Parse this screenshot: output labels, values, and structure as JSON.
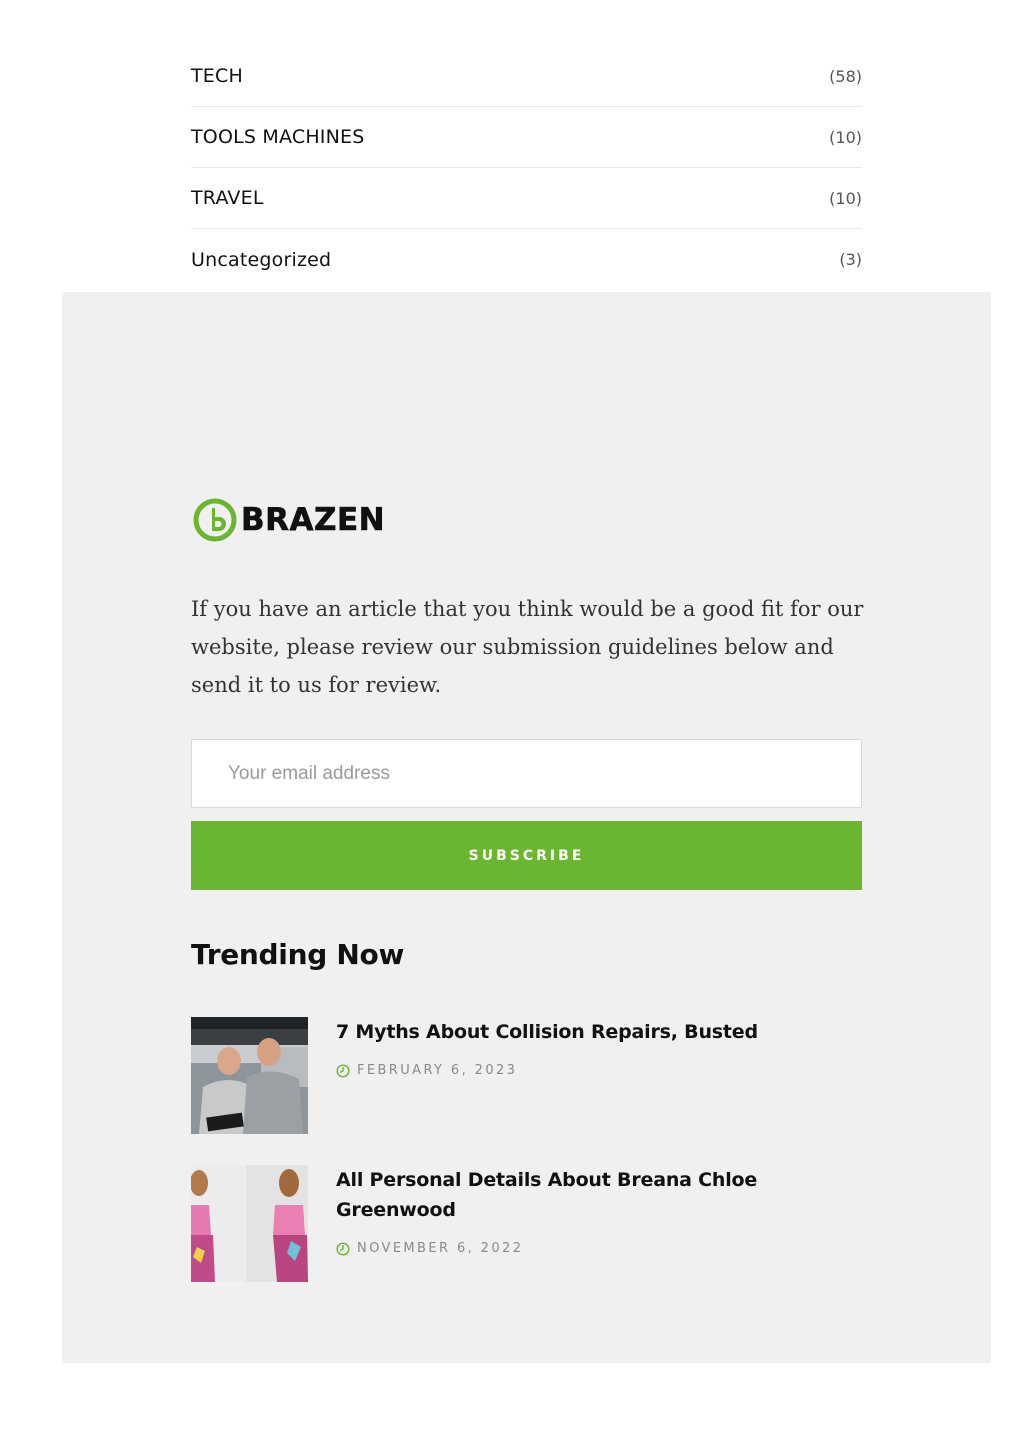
{
  "categories": [
    {
      "name": "TECH",
      "count": "(58)"
    },
    {
      "name": "TOOLS MACHINES",
      "count": "(10)"
    },
    {
      "name": "TRAVEL",
      "count": "(10)"
    },
    {
      "name": "Uncategorized",
      "count": "(3)"
    }
  ],
  "widget": {
    "logo_text": "BRAZEN",
    "brand_color": "#6bb630",
    "about_text": "If you have an article that you think would be a good fit for our website, please review our submission guidelines below and send it to us for review.",
    "email_placeholder": "Your email address",
    "subscribe_label": "SUBSCRIBE"
  },
  "trending": {
    "title": "Trending Now",
    "posts": [
      {
        "title": " 7 Myths About Collision Repairs, Busted",
        "date": "FEBRUARY 6, 2023",
        "thumb_icon": "mechanics-photo"
      },
      {
        "title": " All Personal Details About Breana Chloe Greenwood",
        "date": "NOVEMBER 6, 2022",
        "thumb_icon": "fashion-photo"
      }
    ]
  }
}
